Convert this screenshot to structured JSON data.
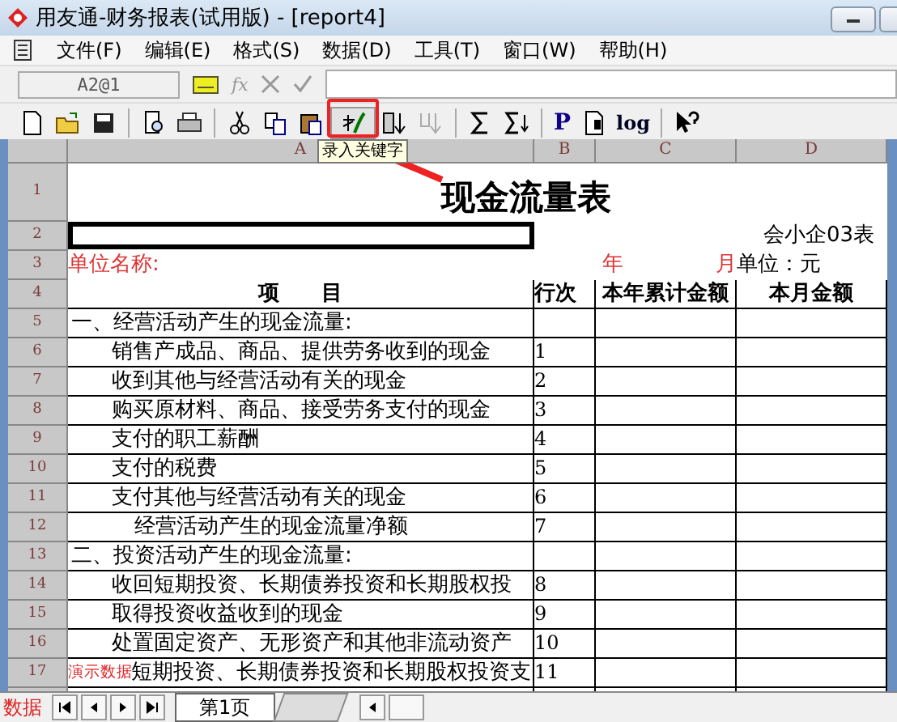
{
  "window": {
    "title": "用友通-财务报表(试用版) - [report4]"
  },
  "menu": [
    {
      "label": "文件(F)"
    },
    {
      "label": "编辑(E)"
    },
    {
      "label": "格式(S)"
    },
    {
      "label": "数据(D)"
    },
    {
      "label": "工具(T)"
    },
    {
      "label": "窗口(W)"
    },
    {
      "label": "帮助(H)"
    }
  ],
  "formula_bar": {
    "cell_ref": "A2@1",
    "fx": "fx"
  },
  "toolbar": {
    "items": [
      {
        "kind": "new"
      },
      {
        "kind": "open"
      },
      {
        "kind": "save"
      },
      {
        "kind": "sep"
      },
      {
        "kind": "preview"
      },
      {
        "kind": "print"
      },
      {
        "kind": "sep"
      },
      {
        "kind": "cut"
      },
      {
        "kind": "copy"
      },
      {
        "kind": "paste"
      },
      {
        "kind": "keyword",
        "highlighted": true
      },
      {
        "kind": "sortdown"
      },
      {
        "kind": "sortup",
        "disabled": true
      },
      {
        "kind": "sep"
      },
      {
        "kind": "sum"
      },
      {
        "kind": "sumdown"
      },
      {
        "kind": "sep"
      },
      {
        "kind": "text",
        "label": "P"
      },
      {
        "kind": "page"
      },
      {
        "kind": "text",
        "label": "log"
      },
      {
        "kind": "sep"
      },
      {
        "kind": "help"
      }
    ],
    "tooltip": "录入关键字"
  },
  "sheet": {
    "columns": [
      "A",
      "B",
      "C",
      "D"
    ],
    "rows": [
      {
        "number": "1",
        "kind": "title",
        "text": "现金流量表"
      },
      {
        "number": "2",
        "kind": "form",
        "selected": true,
        "form_code": "会小企03表"
      },
      {
        "number": "3",
        "kind": "info",
        "unit_name": "单位名称:",
        "year": "年",
        "month": "月",
        "unit": "单位：元"
      },
      {
        "number": "4",
        "kind": "header",
        "cells": [
          "项　　目",
          "行次",
          "本年累计金额",
          "本月金额"
        ]
      },
      {
        "number": "5",
        "kind": "section",
        "text": "一、经营活动产生的现金流量:",
        "line": ""
      },
      {
        "number": "6",
        "kind": "item",
        "text": "销售产成品、商品、提供劳务收到的现金",
        "line": "1"
      },
      {
        "number": "7",
        "kind": "item",
        "text": "收到其他与经营活动有关的现金",
        "line": "2"
      },
      {
        "number": "8",
        "kind": "item",
        "text": "购买原材料、商品、接受劳务支付的现金",
        "line": "3"
      },
      {
        "number": "9",
        "kind": "item",
        "text": "支付的职工薪酬",
        "line": "4"
      },
      {
        "number": "10",
        "kind": "item",
        "text": "支付的税费",
        "line": "5"
      },
      {
        "number": "11",
        "kind": "item",
        "text": "支付其他与经营活动有关的现金",
        "line": "6"
      },
      {
        "number": "12",
        "kind": "subtotal",
        "text": "经营活动产生的现金流量净额",
        "line": "7"
      },
      {
        "number": "13",
        "kind": "section",
        "text": "二、投资活动产生的现金流量:",
        "line": ""
      },
      {
        "number": "14",
        "kind": "item",
        "text": "收回短期投资、长期债券投资和长期股权投",
        "line": "8"
      },
      {
        "number": "15",
        "kind": "item",
        "text": "取得投资收益收到的现金",
        "line": "9"
      },
      {
        "number": "16",
        "kind": "item",
        "text": "处置固定资产、无形资产和其他非流动资产",
        "line": "10"
      },
      {
        "number": "17",
        "kind": "item",
        "text": "短期投资、长期债券投资和长期股权投资支",
        "line": "11",
        "overlay": "演示数据"
      }
    ]
  },
  "sheet_tabs": {
    "mode": "数据",
    "tabs": [
      {
        "label": "第1页",
        "selected": true
      }
    ]
  }
}
